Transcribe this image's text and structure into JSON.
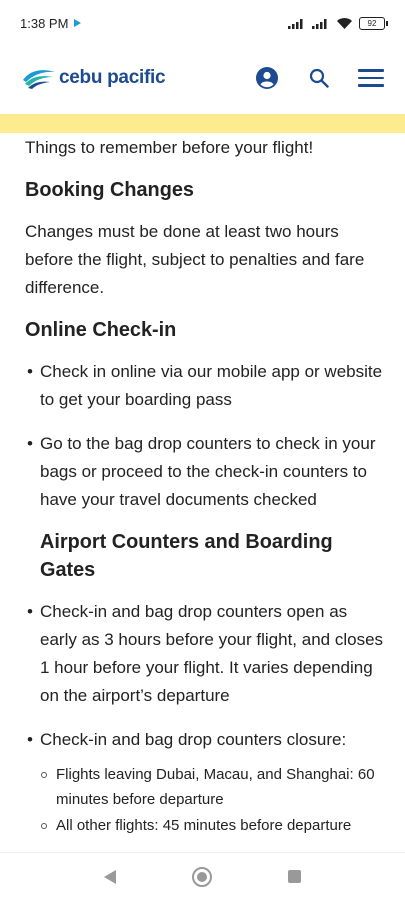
{
  "status_bar": {
    "time": "1:38 PM",
    "battery": "92"
  },
  "header": {
    "logo_text": "cebu pacific",
    "icons": [
      "account-icon",
      "search-icon",
      "menu-icon"
    ]
  },
  "colors": {
    "brand_blue": "#1d4b8f",
    "accent_light_blue": "#1a9bd7",
    "highlight_yellow": "#fdeb90"
  },
  "content": {
    "intro": "Things to remember before your flight!",
    "booking_changes": {
      "title": "Booking Changes",
      "body": "Changes must be done at least two hours before the flight, subject to penalties and fare difference."
    },
    "online_checkin": {
      "title": "Online Check-in",
      "bullets": [
        "Check in online via our mobile app or website to get your boarding pass",
        "Go to the bag drop counters to check in your bags or proceed to the check-in counters to have your travel documents checked"
      ]
    },
    "airport_counters": {
      "title": "Airport Counters and Boarding Gates",
      "bullets": [
        "Check-in and bag drop counters open as early as 3 hours before your flight, and closes 1 hour before your flight. It varies depending on the airport’s departure",
        "Check-in and bag drop counters closure:"
      ],
      "sub_bullets": [
        "Flights leaving Dubai, Macau, and Shanghai: 60 minutes before departure",
        "All other flights: 45 minutes before departure"
      ]
    }
  }
}
